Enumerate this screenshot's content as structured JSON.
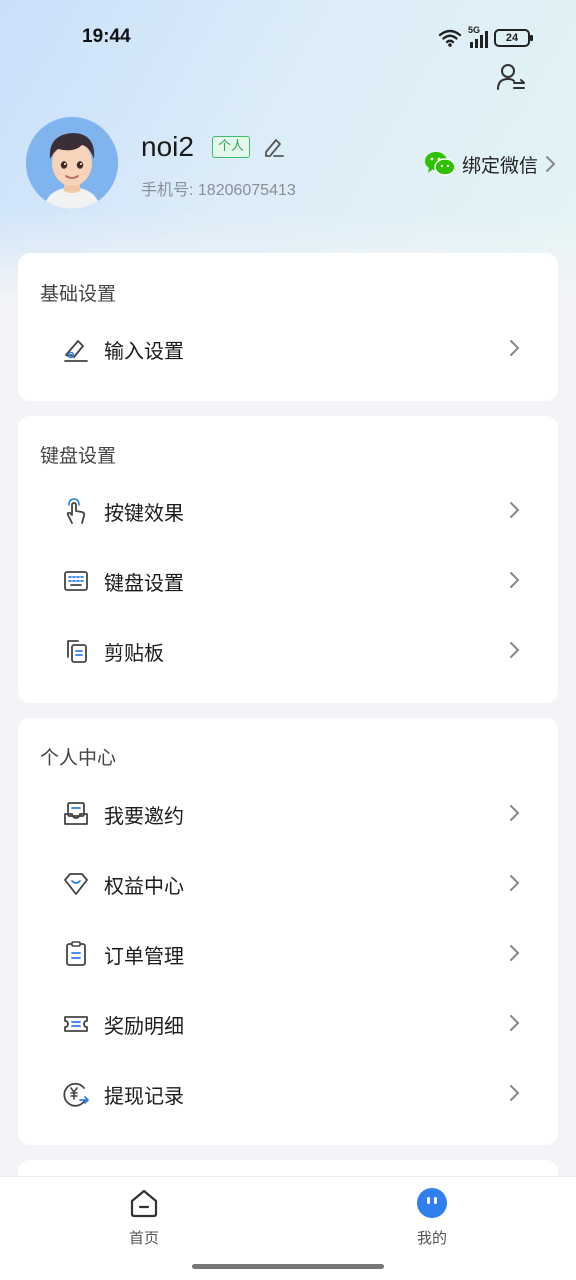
{
  "status_bar": {
    "time": "19:44",
    "network_label": "5G",
    "battery_level": "24"
  },
  "profile": {
    "username": "noi2",
    "badge": "个人",
    "phone_label": "手机号: 18206075413",
    "wechat_label": "绑定微信"
  },
  "sections": [
    {
      "title": "基础设置",
      "items": [
        {
          "label": "输入设置",
          "icon": "pen-edit-icon"
        }
      ]
    },
    {
      "title": "键盘设置",
      "items": [
        {
          "label": "按键效果",
          "icon": "tap-hand-icon"
        },
        {
          "label": "键盘设置",
          "icon": "keyboard-icon"
        },
        {
          "label": "剪贴板",
          "icon": "clipboard-copy-icon"
        }
      ]
    },
    {
      "title": "个人中心",
      "items": [
        {
          "label": "我要邀约",
          "icon": "invite-inbox-icon"
        },
        {
          "label": "权益中心",
          "icon": "diamond-icon"
        },
        {
          "label": "订单管理",
          "icon": "order-clipboard-icon"
        },
        {
          "label": "奖励明细",
          "icon": "ticket-icon"
        },
        {
          "label": "提现记录",
          "icon": "yuan-withdraw-icon"
        }
      ]
    }
  ],
  "bottom_nav": [
    {
      "label": "首页",
      "icon": "home-icon"
    },
    {
      "label": "我的",
      "icon": "profile-face-icon",
      "active": true
    }
  ],
  "colors": {
    "accent": "#2f80ed",
    "badge_green": "#2aaa56",
    "wechat_green": "#2dc100"
  }
}
